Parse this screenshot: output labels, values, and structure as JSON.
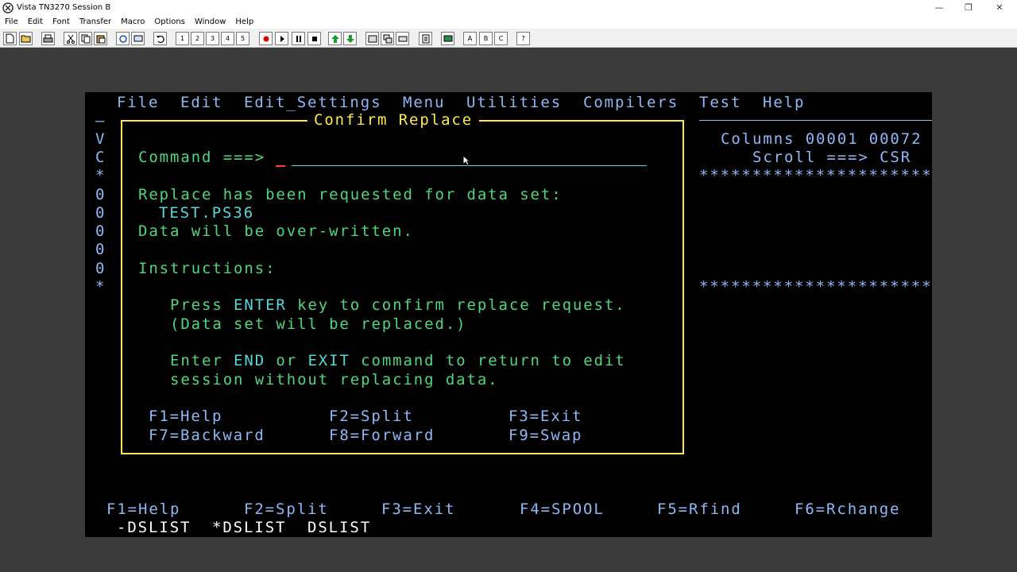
{
  "window": {
    "title": "Vista TN3270 Session B",
    "minimize": "—",
    "restore": "❐",
    "close": "✕"
  },
  "menu": [
    "File",
    "Edit",
    "Font",
    "Transfer",
    "Macro",
    "Options",
    "Window",
    "Help"
  ],
  "toolbar": {
    "btn1": "1",
    "btn2": "2",
    "btn3": "3",
    "btn4": "4",
    "btn5": "5",
    "btnA": "A",
    "btnB": "B",
    "btnC": "C",
    "btnHelp": "?"
  },
  "ispf": {
    "menubar": [
      "File",
      "Edit",
      "Edit_Settings",
      "Menu",
      "Utilities",
      "Compilers",
      "Test",
      "Help"
    ],
    "left_column": [
      "—",
      "V",
      "C",
      "*",
      "0",
      "0",
      "0",
      "0",
      "0",
      "*"
    ],
    "columns_line": "Columns 00001 00072",
    "scroll_line": "Scroll ===> CSR",
    "stars_line": "***********************",
    "dialog": {
      "title": "Confirm Replace",
      "command_prompt": "Command ===>",
      "line1": "Replace has been requested for data set:",
      "dataset": "TEST.PS36",
      "line2": "Data will be over-written.",
      "instructions_label": "Instructions:",
      "instr1_pre": "Press ",
      "instr1_key": "ENTER",
      "instr1_post": " key to confirm replace request.",
      "instr2": "(Data set will be replaced.)",
      "instr3_pre": "Enter ",
      "instr3_end": "END",
      "instr3_mid": " or ",
      "instr3_exit": "EXIT",
      "instr3_post": " command to return to edit",
      "instr4": "session without replacing data.",
      "pf1": "F1=Help",
      "pf2": "F2=Split",
      "pf3": "F3=Exit",
      "pf7": "F7=Backward",
      "pf8": "F8=Forward",
      "pf9": "F9=Swap"
    },
    "pfkeys": [
      "F1=Help",
      "F2=Split",
      "F3=Exit",
      "F4=SPOOL",
      "F5=Rfind",
      "F6=Rchange"
    ],
    "bottom_tabs": [
      "-DSLIST",
      "*DSLIST",
      "DSLIST"
    ]
  },
  "colors": {
    "background": "#3b3b3b",
    "terminal": "#000000",
    "blue": "#8fb8f5",
    "green": "#4fd67f",
    "yellow": "#ffe94a",
    "turquoise": "#57d8d8",
    "cursor": "#ff4040"
  }
}
